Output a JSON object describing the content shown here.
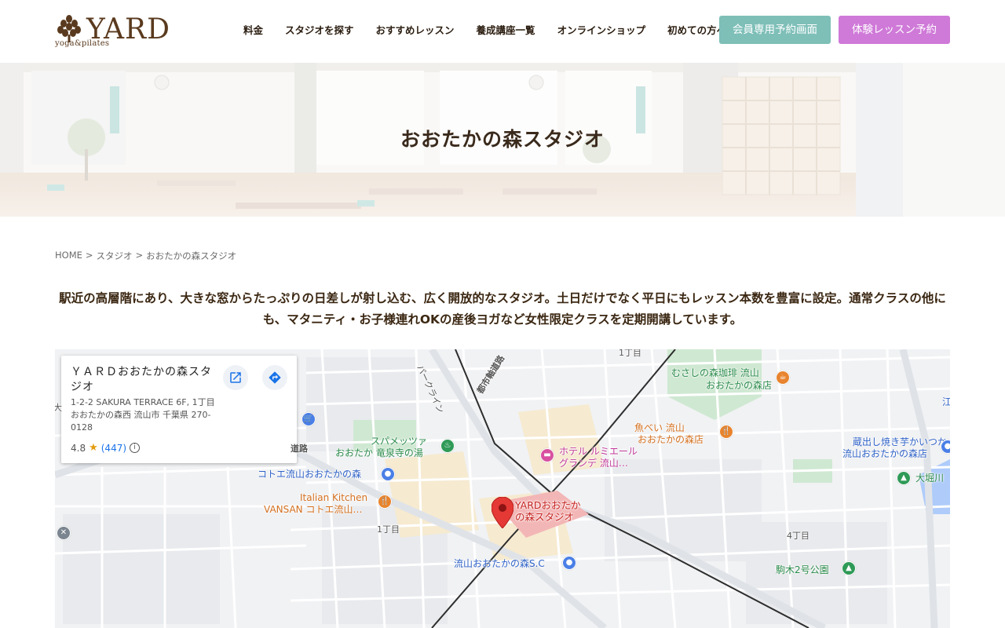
{
  "header": {
    "logo_text": "YARD",
    "logo_sub": "yoga&pilates",
    "nav": [
      "料金",
      "スタジオを探す",
      "おすすめレッスン",
      "養成講座一覧",
      "オンラインショップ",
      "初めての方へ"
    ],
    "member_button": "会員専用予約画面",
    "trial_button": "体験レッスン予約"
  },
  "hero": {
    "title": "おおたかの森スタジオ"
  },
  "breadcrumb": {
    "home": "HOME",
    "sep1": ">",
    "studio": "スタジオ",
    "sep2": ">",
    "current": "おおたかの森スタジオ"
  },
  "intro": {
    "text": "駅近の高層階にあり、大きな窓からたっぷりの日差しが射し込む、広く開放的なスタジオ。土日だけでなく平日にもレッスン本数を豊富に設定。通常クラスの他にも、マタニティ・お子様連れOKの産後ヨガなど女性限定クラスを定期開講しています。"
  },
  "map": {
    "card": {
      "name": "ＹＡＲＤおおたかの森スタジオ",
      "address": "1-2-2 SAKURA TERRACE 6F, 1丁目 おおたかの森西 流山市 千葉県 270-0128",
      "rating": "4.8",
      "reviews": "(447)",
      "info": "i"
    },
    "labels": {
      "chome1_top": "1丁目",
      "road_park": "パークライン",
      "road_toshi": "都市軸道路",
      "musashi_1": "むさしの森珈琲 流山",
      "musashi_2": "おおたかの森店",
      "uobei_1": "魚べい 流山",
      "uobei_2": "おおたかの森店",
      "kura_1": "蔵出し焼き芋かいつか",
      "kura_2": "流山おおたかの森店",
      "oohori": "大堀川",
      "spa_1": "スパメッツァ",
      "spa_2": "おおたか 竜泉寺の湯",
      "hotel_1": "ホテル ルミエール",
      "hotel_2": "グランデ 流山…",
      "dourou": "道路",
      "cotoe": "コトエ流山おおたかの森",
      "italian_1": "Italian Kitchen",
      "italian_2": "VANSAN コトエ流山…",
      "yard_1": "YARDおおたか",
      "yard_2": "の森スタジオ",
      "chome1_mid": "1丁目",
      "chome4": "4丁目",
      "sc": "流山おおたかの森S.C",
      "komagi": "駒木2号公園",
      "edge_left": "大",
      "edge_right": "江"
    }
  }
}
